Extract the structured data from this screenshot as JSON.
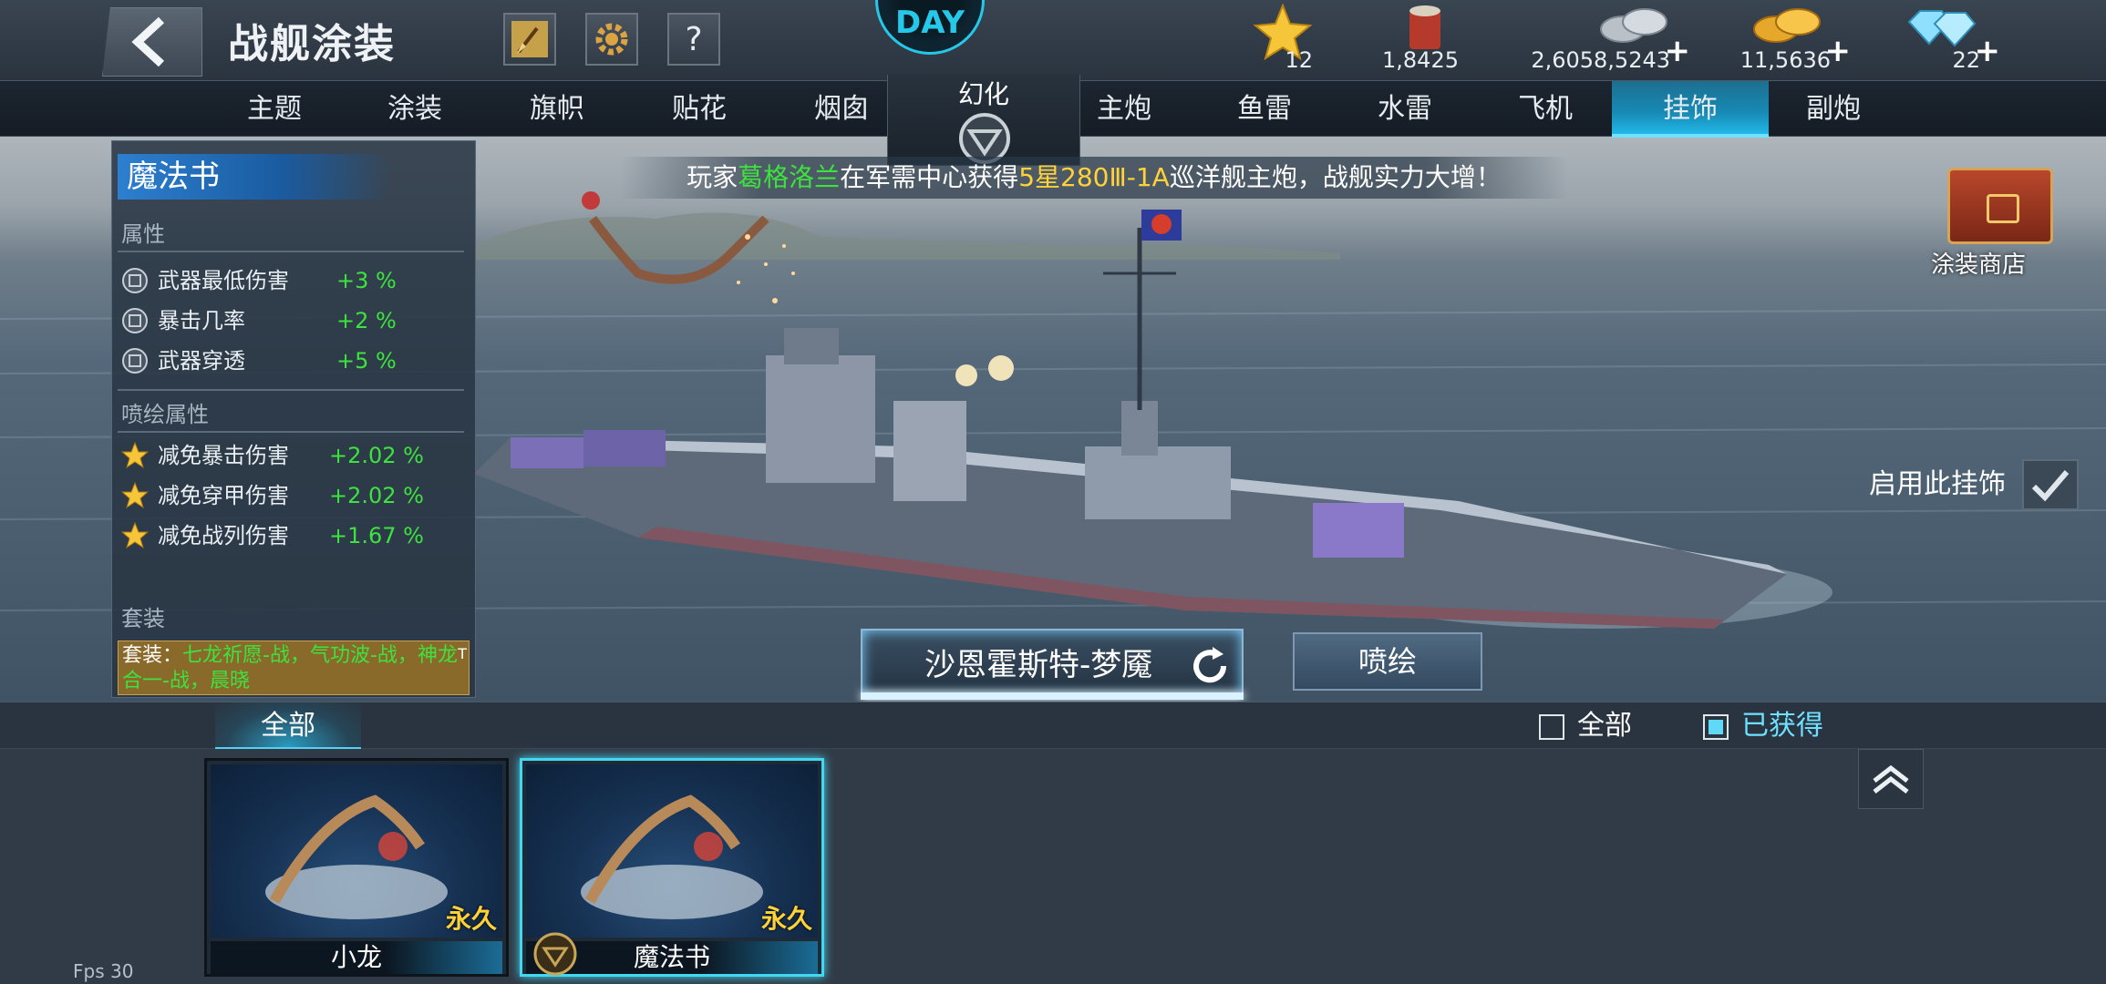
{
  "header": {
    "title": "战舰涂装",
    "logo_text": "DAY"
  },
  "resources": [
    {
      "icon": "star-icon",
      "value": "12"
    },
    {
      "icon": "paint-bucket-icon",
      "value": "1,8425"
    },
    {
      "icon": "silver-coins-icon",
      "value": "2,6058,5243",
      "plus": "+"
    },
    {
      "icon": "gold-coins-icon",
      "value": "11,5636",
      "plus": "+"
    },
    {
      "icon": "diamond-icon",
      "value": "22",
      "plus": "+"
    }
  ],
  "tabs": [
    {
      "label": "主题"
    },
    {
      "label": "涂装"
    },
    {
      "label": "旗帜"
    },
    {
      "label": "贴花"
    },
    {
      "label": "烟囱"
    },
    {
      "label": "幻化"
    },
    {
      "label": "主炮"
    },
    {
      "label": "鱼雷"
    },
    {
      "label": "水雷"
    },
    {
      "label": "飞机"
    },
    {
      "label": "挂饰",
      "active": true
    },
    {
      "label": "副炮"
    }
  ],
  "panel": {
    "title": "魔法书",
    "attr_section": "属性",
    "attributes": [
      {
        "name": "武器最低伤害",
        "value": "+3 %"
      },
      {
        "name": "暴击几率",
        "value": "+2 %"
      },
      {
        "name": "武器穿透",
        "value": "+5 %"
      }
    ],
    "spray_section": "喷绘属性",
    "spray_attributes": [
      {
        "name": "减免暴击伤害",
        "value": "+2.02 %"
      },
      {
        "name": "减免穿甲伤害",
        "value": "+2.02 %"
      },
      {
        "name": "减免战列伤害",
        "value": "+1.67 %"
      }
    ],
    "set_section": "套装",
    "set_prefix": "套装：",
    "set_text": "七龙祈愿-战，气功波-战，神龙合一-战，晨晓",
    "set_tag": "T"
  },
  "ticker": {
    "p1": "玩家",
    "player": "葛格洛兰",
    "p2": "在军需中心获得",
    "item": "5星280Ⅲ-1A",
    "p3": "巡洋舰主炮，战舰实力大增！"
  },
  "shop_label": "涂装商店",
  "enable_label": "启用此挂饰",
  "ship_name": "沙恩霍斯特-梦魇",
  "spray_button": "喷绘",
  "filter": {
    "tab_all": "全部",
    "all": "全部",
    "obtained": "已获得"
  },
  "items": [
    {
      "name": "小龙",
      "duration": "永久",
      "selected": false
    },
    {
      "name": "魔法书",
      "duration": "永久",
      "selected": true
    }
  ],
  "fps": "Fps 30",
  "colors": {
    "accent": "#42d7f2",
    "stat_green": "#3ee23e",
    "gold": "#ffd23a"
  }
}
